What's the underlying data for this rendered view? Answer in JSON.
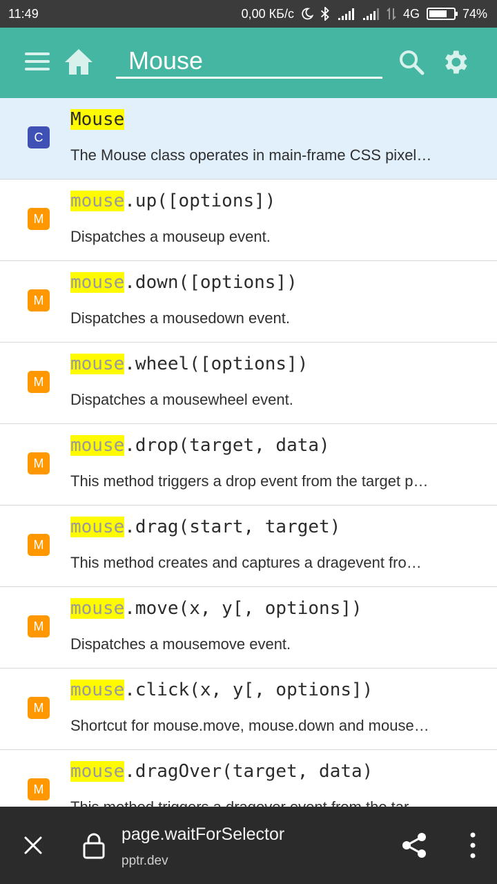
{
  "status_bar": {
    "time": "11:49",
    "net_speed": "0,00 КБ/с",
    "network": "4G",
    "battery": "74%",
    "battery_level": 0.74,
    "icons": [
      "moon-icon",
      "bluetooth-icon",
      "signal-icon",
      "signal-icon",
      "data-transfer-icon",
      "battery-icon"
    ]
  },
  "app_bar": {
    "background": "#45b6a1",
    "search_value": "Mouse",
    "icons": [
      "menu-icon",
      "home-icon",
      "search-icon",
      "gear-icon"
    ]
  },
  "results": [
    {
      "badge": "C",
      "badge_color": "#3f51b5",
      "highlight": "Mouse",
      "rest": "",
      "description": "The Mouse class operates in main-frame CSS pixel…",
      "selected": true
    },
    {
      "badge": "M",
      "badge_color": "#ff9800",
      "highlight": "mouse",
      "rest": ".up([options])",
      "description": "Dispatches a mouseup event.",
      "selected": false
    },
    {
      "badge": "M",
      "badge_color": "#ff9800",
      "highlight": "mouse",
      "rest": ".down([options])",
      "description": "Dispatches a mousedown event.",
      "selected": false
    },
    {
      "badge": "M",
      "badge_color": "#ff9800",
      "highlight": "mouse",
      "rest": ".wheel([options])",
      "description": "Dispatches a mousewheel event.",
      "selected": false
    },
    {
      "badge": "M",
      "badge_color": "#ff9800",
      "highlight": "mouse",
      "rest": ".drop(target, data)",
      "description": "This method triggers a drop event from the target p…",
      "selected": false
    },
    {
      "badge": "M",
      "badge_color": "#ff9800",
      "highlight": "mouse",
      "rest": ".drag(start, target)",
      "description": "This method creates and captures a dragevent fro…",
      "selected": false
    },
    {
      "badge": "M",
      "badge_color": "#ff9800",
      "highlight": "mouse",
      "rest": ".move(x, y[, options])",
      "description": "Dispatches a mousemove event.",
      "selected": false
    },
    {
      "badge": "M",
      "badge_color": "#ff9800",
      "highlight": "mouse",
      "rest": ".click(x, y[, options])",
      "description": "Shortcut for mouse.move, mouse.down and mouse…",
      "selected": false
    },
    {
      "badge": "M",
      "badge_color": "#ff9800",
      "highlight": "mouse",
      "rest": ".dragOver(target, data)",
      "description": "This method triggers a dragover event from the tar…",
      "selected": false
    }
  ],
  "bottom_bar": {
    "page_title": "page.waitForSelector",
    "host": "pptr.dev",
    "icons": [
      "close-icon",
      "lock-icon",
      "share-icon",
      "more-vert-icon"
    ]
  }
}
